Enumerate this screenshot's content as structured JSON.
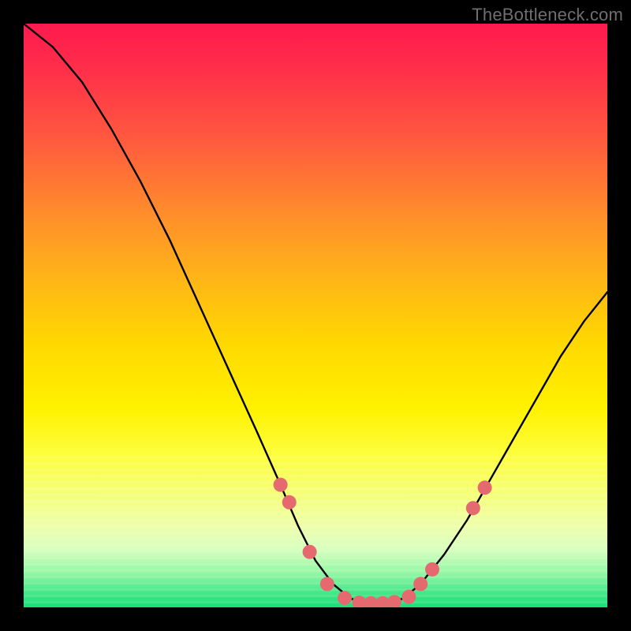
{
  "watermark": "TheBottleneck.com",
  "chart_data": {
    "type": "line",
    "title": "",
    "xlabel": "",
    "ylabel": "",
    "xlim": [
      0,
      100
    ],
    "ylim": [
      0,
      100
    ],
    "grid": false,
    "legend": false,
    "series": [
      {
        "name": "bottleneck-curve",
        "color": "#000000",
        "x": [
          0,
          5,
          10,
          15,
          20,
          25,
          30,
          35,
          40,
          44,
          47,
          50,
          53,
          56,
          59,
          62,
          65,
          68,
          72,
          76,
          80,
          84,
          88,
          92,
          96,
          100
        ],
        "y": [
          100,
          96,
          90,
          82,
          73,
          63,
          52,
          41,
          30,
          21,
          14,
          8,
          4,
          1.5,
          0.7,
          0.7,
          1.5,
          4,
          9,
          15,
          22,
          29,
          36,
          43,
          49,
          54
        ]
      }
    ],
    "markers": {
      "name": "highlight-dots",
      "color": "#e46a6f",
      "radius": 9,
      "points": [
        {
          "x": 44.0,
          "y": 21.0
        },
        {
          "x": 45.5,
          "y": 18.0
        },
        {
          "x": 49.0,
          "y": 9.5
        },
        {
          "x": 52.0,
          "y": 4.0
        },
        {
          "x": 55.0,
          "y": 1.6
        },
        {
          "x": 57.5,
          "y": 0.8
        },
        {
          "x": 59.5,
          "y": 0.7
        },
        {
          "x": 61.5,
          "y": 0.7
        },
        {
          "x": 63.5,
          "y": 0.9
        },
        {
          "x": 66.0,
          "y": 1.8
        },
        {
          "x": 68.0,
          "y": 4.0
        },
        {
          "x": 70.0,
          "y": 6.5
        },
        {
          "x": 77.0,
          "y": 17.0
        },
        {
          "x": 79.0,
          "y": 20.5
        }
      ]
    }
  }
}
